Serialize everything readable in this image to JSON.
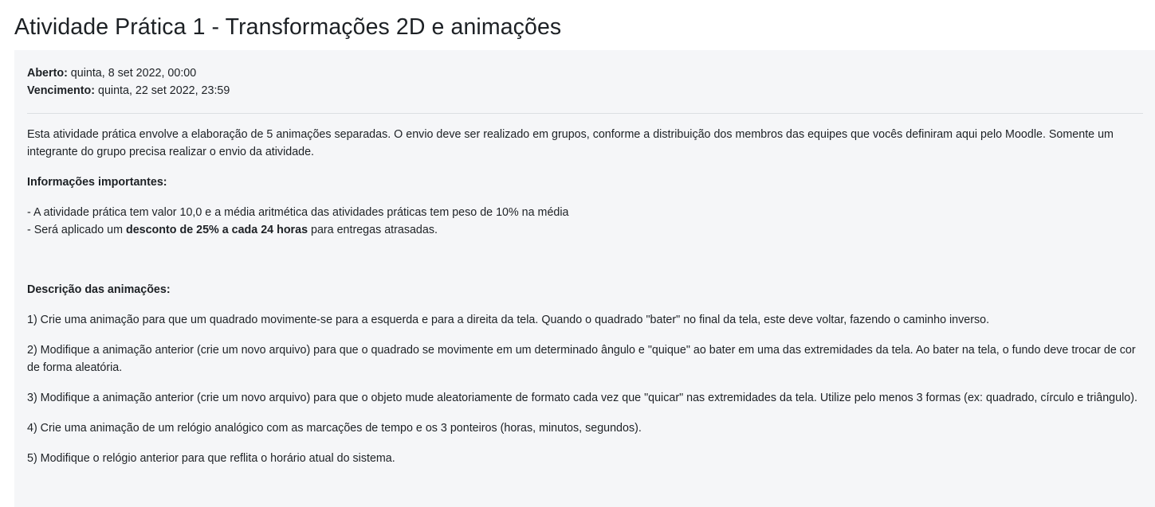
{
  "page_title": "Atividade Prática 1 - Transformações 2D e animações",
  "dates": {
    "opened_label": "Aberto:",
    "opened_value": " quinta, 8 set 2022, 00:00",
    "due_label": "Vencimento:",
    "due_value": " quinta, 22 set 2022, 23:59"
  },
  "intro": "Esta atividade prática envolve a elaboração de 5 animações separadas. O envio deve ser realizado em grupos, conforme a distribuição dos membros das equipes que vocês definiram aqui pelo Moodle. Somente um integrante do grupo precisa realizar o envio da atividade.",
  "important": {
    "heading": "Informações importantes:",
    "line1": "- A atividade prática tem valor 10,0 e a média aritmética das atividades práticas tem peso de 10% na média",
    "line2_pre": "- Será aplicado um ",
    "line2_bold": "desconto de 25% a cada 24 horas",
    "line2_post": " para entregas atrasadas."
  },
  "description": {
    "heading": "Descrição das animações:",
    "items": [
      "1) Crie uma animação para que um quadrado movimente-se para a esquerda e para a direita da tela. Quando o quadrado \"bater\" no final da tela, este deve voltar, fazendo o caminho inverso.",
      "2) Modifique a animação anterior (crie um novo arquivo) para que o quadrado se movimente em um determinado ângulo e \"quique\" ao bater em uma das extremidades da tela. Ao bater na tela, o fundo deve trocar de cor de forma aleatória.",
      "3) Modifique a animação anterior (crie um novo arquivo) para que o objeto mude aleatoriamente de formato cada vez que \"quicar\" nas extremidades da tela. Utilize pelo menos 3 formas (ex: quadrado, círculo e triângulo).",
      "4) Crie uma animação de um relógio analógico com as marcações de tempo e os 3 ponteiros (horas, minutos, segundos).",
      "5) Modifique o relógio anterior para que reflita o horário atual do sistema."
    ]
  }
}
